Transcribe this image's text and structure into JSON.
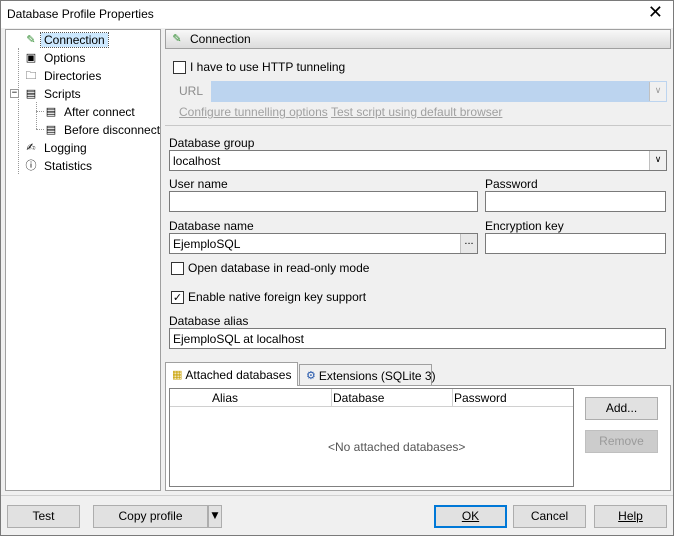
{
  "window": {
    "title": "Database Profile Properties"
  },
  "tree": {
    "items": [
      {
        "label": "Connection"
      },
      {
        "label": "Options"
      },
      {
        "label": "Directories"
      },
      {
        "label": "Scripts"
      },
      {
        "label": "After connect"
      },
      {
        "label": "Before disconnect"
      },
      {
        "label": "Logging"
      },
      {
        "label": "Statistics"
      }
    ]
  },
  "panel": {
    "header": "Connection",
    "http_tunneling": {
      "label": "I have to use HTTP tunneling",
      "checked": false
    },
    "url": {
      "label": "URL",
      "value": ""
    },
    "links": {
      "configure": "Configure tunnelling options",
      "test_script": "Test script using default browser"
    },
    "database_group": {
      "label": "Database group",
      "value": "localhost"
    },
    "user_name": {
      "label": "User name",
      "value": ""
    },
    "password": {
      "label": "Password",
      "value": ""
    },
    "database_name": {
      "label": "Database name",
      "value": "EjemploSQL"
    },
    "encryption_key": {
      "label": "Encryption key",
      "value": ""
    },
    "read_only": {
      "label": "Open database in read-only mode",
      "checked": false
    },
    "foreign_key": {
      "label": "Enable native foreign key support",
      "checked": true
    },
    "database_alias": {
      "label": "Database alias",
      "value": "EjemploSQL at localhost"
    },
    "tabs": [
      {
        "label": "Attached databases"
      },
      {
        "label": "Extensions (SQLite 3)"
      }
    ],
    "attached": {
      "columns": [
        "Alias",
        "Database",
        "Password"
      ],
      "empty_text": "<No attached databases>",
      "add_label": "Add...",
      "remove_label": "Remove"
    }
  },
  "footer": {
    "test": "Test",
    "copy_profile": "Copy profile",
    "ok": "OK",
    "cancel": "Cancel",
    "help": "Help"
  },
  "colors": {
    "selection": "#cce8ff",
    "default_button": "#0078d7",
    "disabled_input": "#bcd4ef"
  },
  "icons": {
    "connection": "plug-icon",
    "options": "options-icon",
    "directories": "folder-icon",
    "scripts": "script-icon",
    "logging": "log-icon",
    "statistics": "info-icon"
  }
}
